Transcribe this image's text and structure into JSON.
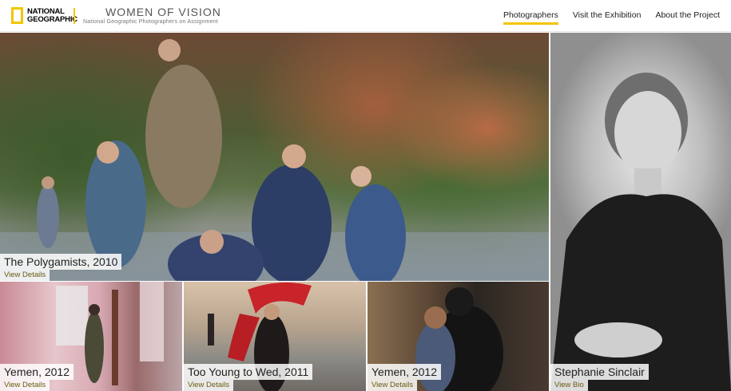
{
  "header": {
    "logo_line1": "NATIONAL",
    "logo_line2": "GEOGRAPHIC",
    "title": "WOMEN OF VISION",
    "subtitle": "National Geographic Photographers on Assignment",
    "accent_color": "#f2c500"
  },
  "nav": {
    "items": [
      {
        "label": "Photographers",
        "active": true
      },
      {
        "label": "Visit the Exhibition",
        "active": false
      },
      {
        "label": "About the Project",
        "active": false
      }
    ]
  },
  "tiles": {
    "hero": {
      "title": "The Polygamists, 2010",
      "link": "View Details"
    },
    "photo1": {
      "title": "Yemen, 2012",
      "link": "View Details"
    },
    "photo2": {
      "title": "Too Young to Wed, 2011",
      "link": "View Details"
    },
    "photo3": {
      "title": "Yemen, 2012",
      "link": "View Details"
    },
    "portrait": {
      "title": "Stephanie Sinclair",
      "link": "View Bio"
    }
  }
}
